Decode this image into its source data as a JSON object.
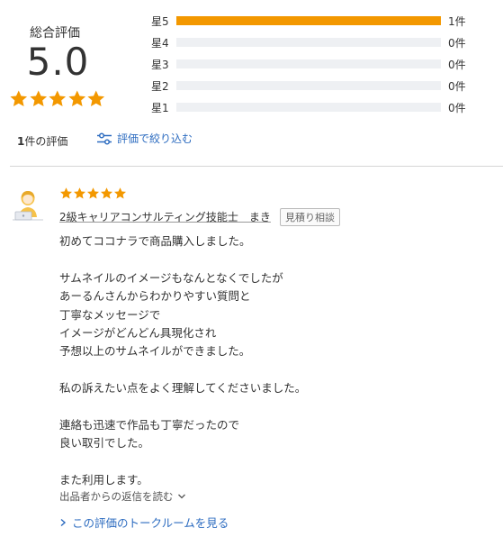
{
  "summary": {
    "label": "総合評価",
    "score": "5.0",
    "stars": 5,
    "star_color": "#f39800"
  },
  "breakdown": [
    {
      "label": "星5",
      "count": "1件",
      "fraction": 1.0
    },
    {
      "label": "星4",
      "count": "0件",
      "fraction": 0.0
    },
    {
      "label": "星3",
      "count": "0件",
      "fraction": 0.0
    },
    {
      "label": "星2",
      "count": "0件",
      "fraction": 0.0
    },
    {
      "label": "星1",
      "count": "0件",
      "fraction": 0.0
    }
  ],
  "count_line": {
    "number": "1",
    "suffix": "件の評価"
  },
  "filter": {
    "label": "評価で絞り込む",
    "icon": "sliders-icon",
    "color": "#2d6cc0"
  },
  "review": {
    "stars": 5,
    "reviewer": "2級キャリアコンサルティング技能士　まき",
    "badge": "見積り相談",
    "lines": [
      "初めてココナラで商品購入しました。",
      "",
      "サムネイルのイメージもなんとなくでしたが",
      "あーるんさんからわかりやすい質問と",
      "丁寧なメッセージで",
      "イメージがどんどん具現化され",
      "予想以上のサムネイルができました。",
      "",
      "私の訴えたい点をよく理解してくださいました。",
      "",
      "連絡も迅速で作品も丁寧だったので",
      "良い取引でした。",
      "",
      "また利用します。"
    ],
    "highlighted_lines": [
      5,
      6,
      13
    ],
    "highlight_color": "#ffe58a",
    "reply_toggle": "出品者からの返信を読む",
    "talkroom_link": "この評価のトークルームを見る"
  }
}
